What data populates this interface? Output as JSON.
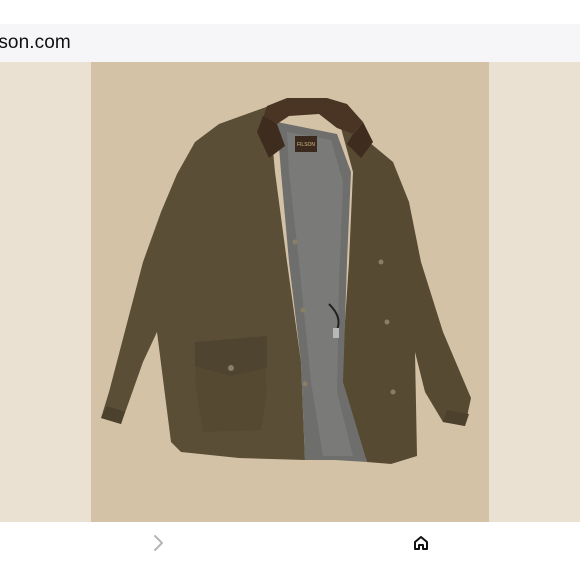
{
  "browser": {
    "url_text": "lson.com"
  },
  "product_image": {
    "description_icon": "jacket-photo",
    "brand_tag_text": "FILSON",
    "colors": {
      "outer_background": "#ebe1d3",
      "panel_background": "#d4c2a7",
      "jacket": "#5a4e36",
      "collar": "#4a3424",
      "lining": "#6e6f6c"
    }
  },
  "bottom_nav": {
    "next_icon": "chevron-right-icon",
    "home_icon": "home-icon"
  }
}
